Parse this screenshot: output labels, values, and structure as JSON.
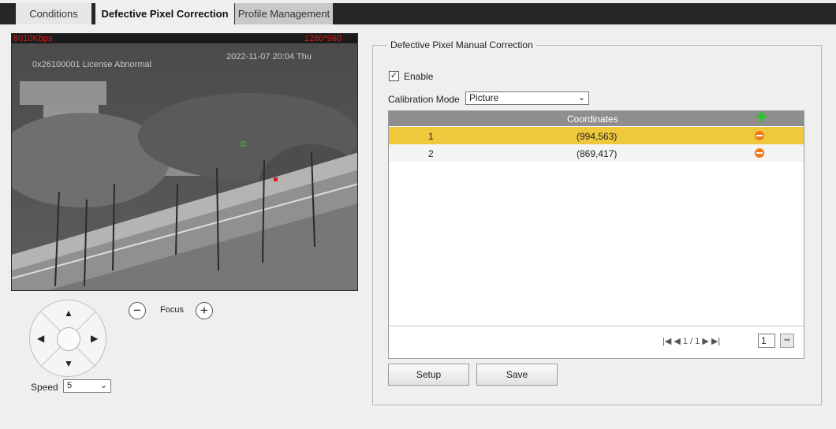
{
  "tabs": [
    {
      "label": "Conditions"
    },
    {
      "label": "Defective Pixel Correction"
    },
    {
      "label": "Profile Management"
    }
  ],
  "video": {
    "bitrate": "8010Kbps",
    "resolution": "1280*960",
    "license_text": "0x26100001   License Abnormal",
    "timestamp": "2022-11-07 20:04 Thu"
  },
  "ptz": {
    "focus_label": "Focus",
    "focus_minus": "−",
    "focus_plus": "+",
    "speed_label": "Speed",
    "speed_value": "5",
    "up": "▲",
    "down": "▼",
    "left": "◀",
    "right": "▶"
  },
  "panel": {
    "legend": "Defective Pixel Manual Correction",
    "enable_label": "Enable",
    "enable_check": "✓",
    "calibration_label": "Calibration Mode",
    "calibration_value": "Picture",
    "table": {
      "column_coordinates": "Coordinates",
      "add_icon": "✚",
      "rows": [
        {
          "index": "1",
          "coordinates": "(994,563)"
        },
        {
          "index": "2",
          "coordinates": "(869,417)"
        }
      ]
    },
    "pager": {
      "first": "|◀",
      "prev": "◀",
      "page_info": "1 / 1",
      "next": "▶",
      "last": "▶|",
      "page_input": "1",
      "go": "➡"
    },
    "setup_label": "Setup",
    "save_label": "Save"
  },
  "icons": {
    "chevron": "⌄"
  }
}
